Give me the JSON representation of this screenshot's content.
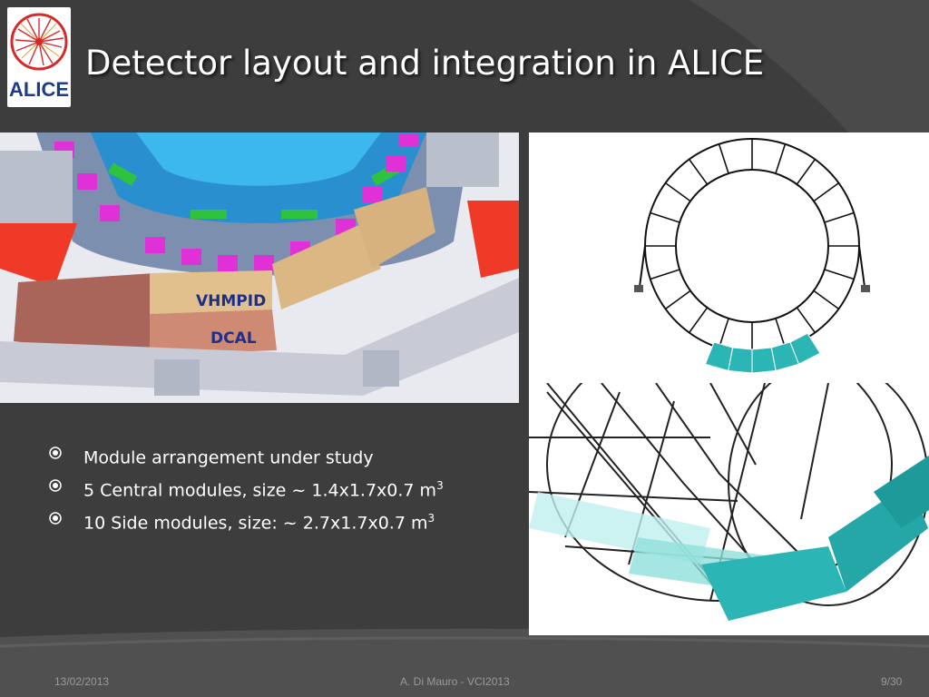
{
  "slide": {
    "title": "Detector layout and integration in ALICE",
    "logo_text": "ALICE",
    "image_labels": {
      "vhmpid": "VHMPID",
      "dcal": "DCAL"
    },
    "bullets": [
      {
        "text": "Module arrangement  under study",
        "sup": ""
      },
      {
        "text": "5 Central modules, size ~ 1.4x1.7x0.7 m",
        "sup": "3"
      },
      {
        "text": "10 Side modules, size: ~ 2.7x1.7x0.7 m",
        "sup": "3"
      }
    ],
    "footer": {
      "date": "13/02/2013",
      "author": "A. Di Mauro - VCI2013",
      "page": "9/30"
    }
  },
  "colors": {
    "background": "#3d3d3d",
    "title": "#ffffff",
    "label": "#1c2f8c",
    "module_teal": "#2bb5b5",
    "logo_red": "#d62a2a"
  },
  "icons": {
    "bullet": "circle-dot-icon",
    "logo": "alice-logo-icon"
  }
}
